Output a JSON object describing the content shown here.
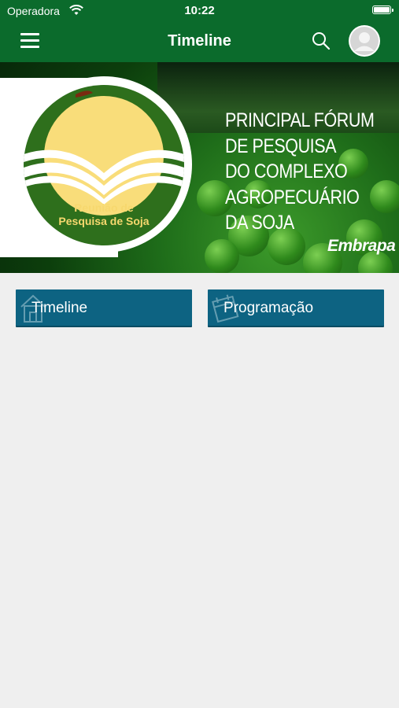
{
  "status_bar": {
    "carrier": "Operadora",
    "time": "10:22",
    "wifi_icon": "wifi-icon",
    "battery_icon": "battery-icon"
  },
  "nav_bar": {
    "title": "Timeline",
    "menu_icon": "hamburger-menu-icon",
    "search_icon": "search-icon",
    "avatar_icon": "user-avatar-icon",
    "background_color": "#0b6b2c"
  },
  "banner": {
    "logo_text_line1": "Reunião de",
    "logo_text_line2": "Pesquisa de Soja",
    "headline_lines": [
      "PRINCIPAL FÓRUM",
      "DE PESQUISA",
      "DO COMPLEXO",
      "AGROPECUÁRIO",
      "DA SOJA"
    ],
    "brand": "Embrapa"
  },
  "tiles": [
    {
      "label": "Timeline",
      "icon": "house-icon"
    },
    {
      "label": "Programação",
      "icon": "calendar-icon"
    }
  ],
  "colors": {
    "tile_background": "#0d6382",
    "page_background": "#efefef",
    "logo_sun": "#f9dd7a",
    "logo_green": "#2e6f1c"
  }
}
